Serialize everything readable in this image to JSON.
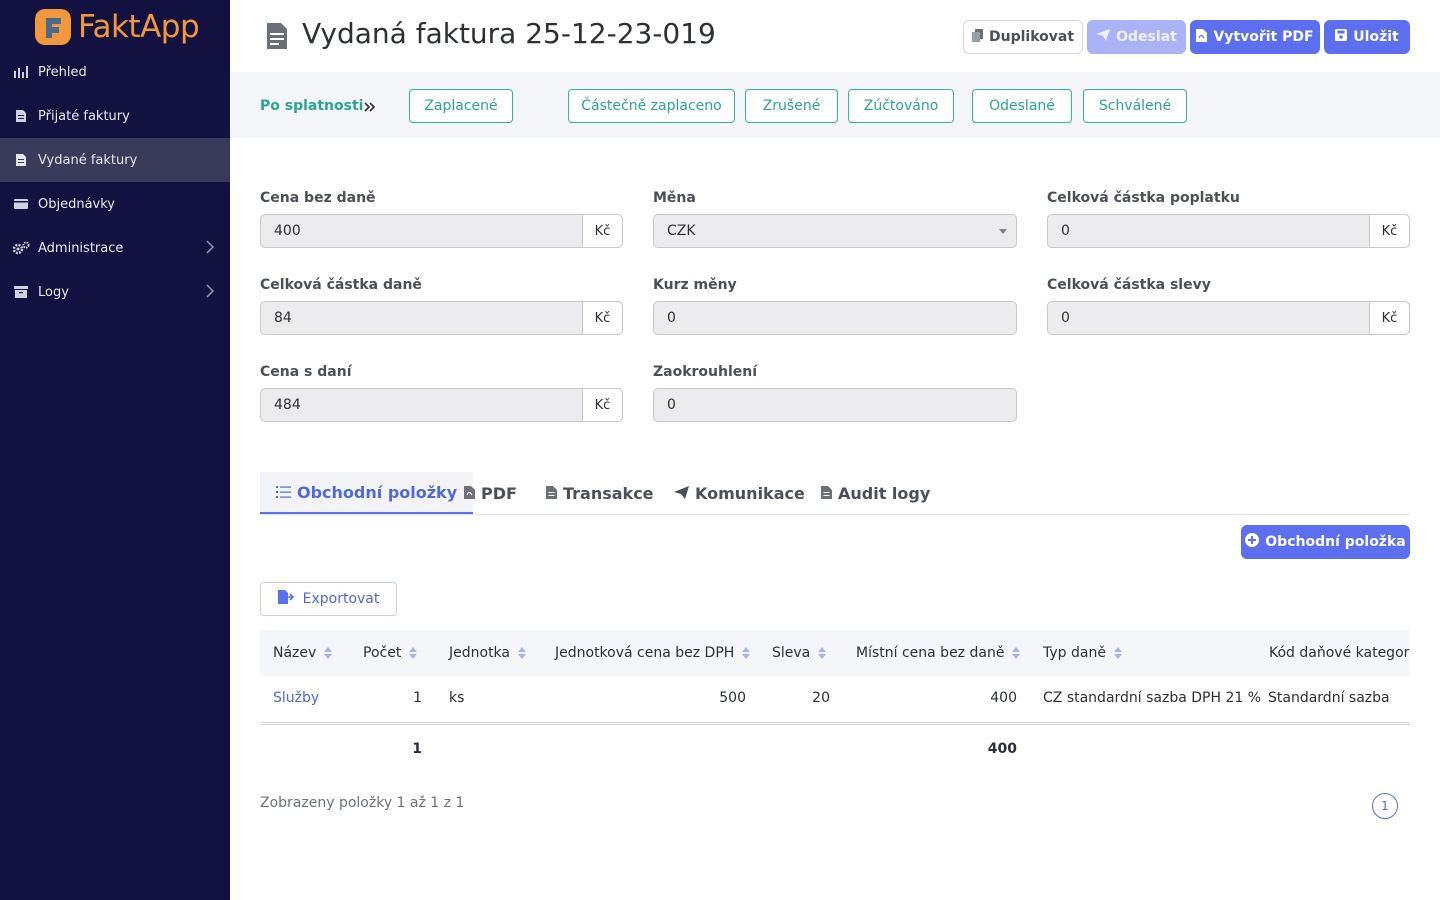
{
  "app": {
    "name": "FaktApp"
  },
  "sidebar": {
    "items": [
      {
        "label": "Přehled",
        "icon": "chart-icon"
      },
      {
        "label": "Přijaté faktury",
        "icon": "document-icon"
      },
      {
        "label": "Vydané faktury",
        "icon": "document-icon",
        "active": true
      },
      {
        "label": "Objednávky",
        "icon": "wallet-icon"
      },
      {
        "label": "Administrace",
        "icon": "gears-icon",
        "has_children": true
      },
      {
        "label": "Logy",
        "icon": "archive-icon",
        "has_children": true
      }
    ]
  },
  "header": {
    "title": "Vydaná faktura 25-12-23-019",
    "buttons": {
      "duplicate": "Duplikovat",
      "send": "Odeslat",
      "pdf": "Vytvořit PDF",
      "save": "Uložit"
    }
  },
  "status": {
    "current": "Po splatnosti",
    "options": [
      "Zaplacené",
      "Částečně zaplaceno",
      "Zrušené",
      "Zúčtováno",
      "Odeslané",
      "Schválené"
    ]
  },
  "form": {
    "price_without_tax": {
      "label": "Cena bez daně",
      "value": "400",
      "unit": "Kč"
    },
    "currency": {
      "label": "Měna",
      "value": "CZK"
    },
    "fee_total": {
      "label": "Celková částka poplatku",
      "value": "0",
      "unit": "Kč"
    },
    "tax_total": {
      "label": "Celková částka daně",
      "value": "84",
      "unit": "Kč"
    },
    "exchange_rate": {
      "label": "Kurz měny",
      "value": "0"
    },
    "discount_total": {
      "label": "Celková částka slevy",
      "value": "0",
      "unit": "Kč"
    },
    "price_with_tax": {
      "label": "Cena s daní",
      "value": "484",
      "unit": "Kč"
    },
    "rounding": {
      "label": "Zaokrouhlení",
      "value": "0"
    }
  },
  "tabs": [
    {
      "label": "Obchodní položky",
      "active": true
    },
    {
      "label": "PDF"
    },
    {
      "label": "Transakce"
    },
    {
      "label": "Komunikace"
    },
    {
      "label": "Audit logy"
    }
  ],
  "actions": {
    "add_item": "Obchodní položka",
    "export": "Exportovat"
  },
  "table": {
    "columns": [
      "Název",
      "Počet",
      "Jednotka",
      "Jednotková cena bez DPH",
      "Sleva",
      "Místní cena bez daně",
      "Typ daně",
      "Kód daňové kategorie"
    ],
    "rows": [
      {
        "name": "Služby",
        "count": "1",
        "unit": "ks",
        "unit_price": "500",
        "discount": "20",
        "local_price": "400",
        "tax_type": "CZ standardní sazba DPH 21 %",
        "tax_category": "Standardní sazba"
      }
    ],
    "footer": {
      "count": "1",
      "local_price": "400"
    }
  },
  "pagination": {
    "info": "Zobrazeny položky 1 až 1 z 1",
    "page": "1"
  },
  "colors": {
    "sidebar": "#13113f",
    "accent": "#5b6ff0",
    "status_green": "#2ca58d",
    "logo_orange": "#f1973c"
  }
}
